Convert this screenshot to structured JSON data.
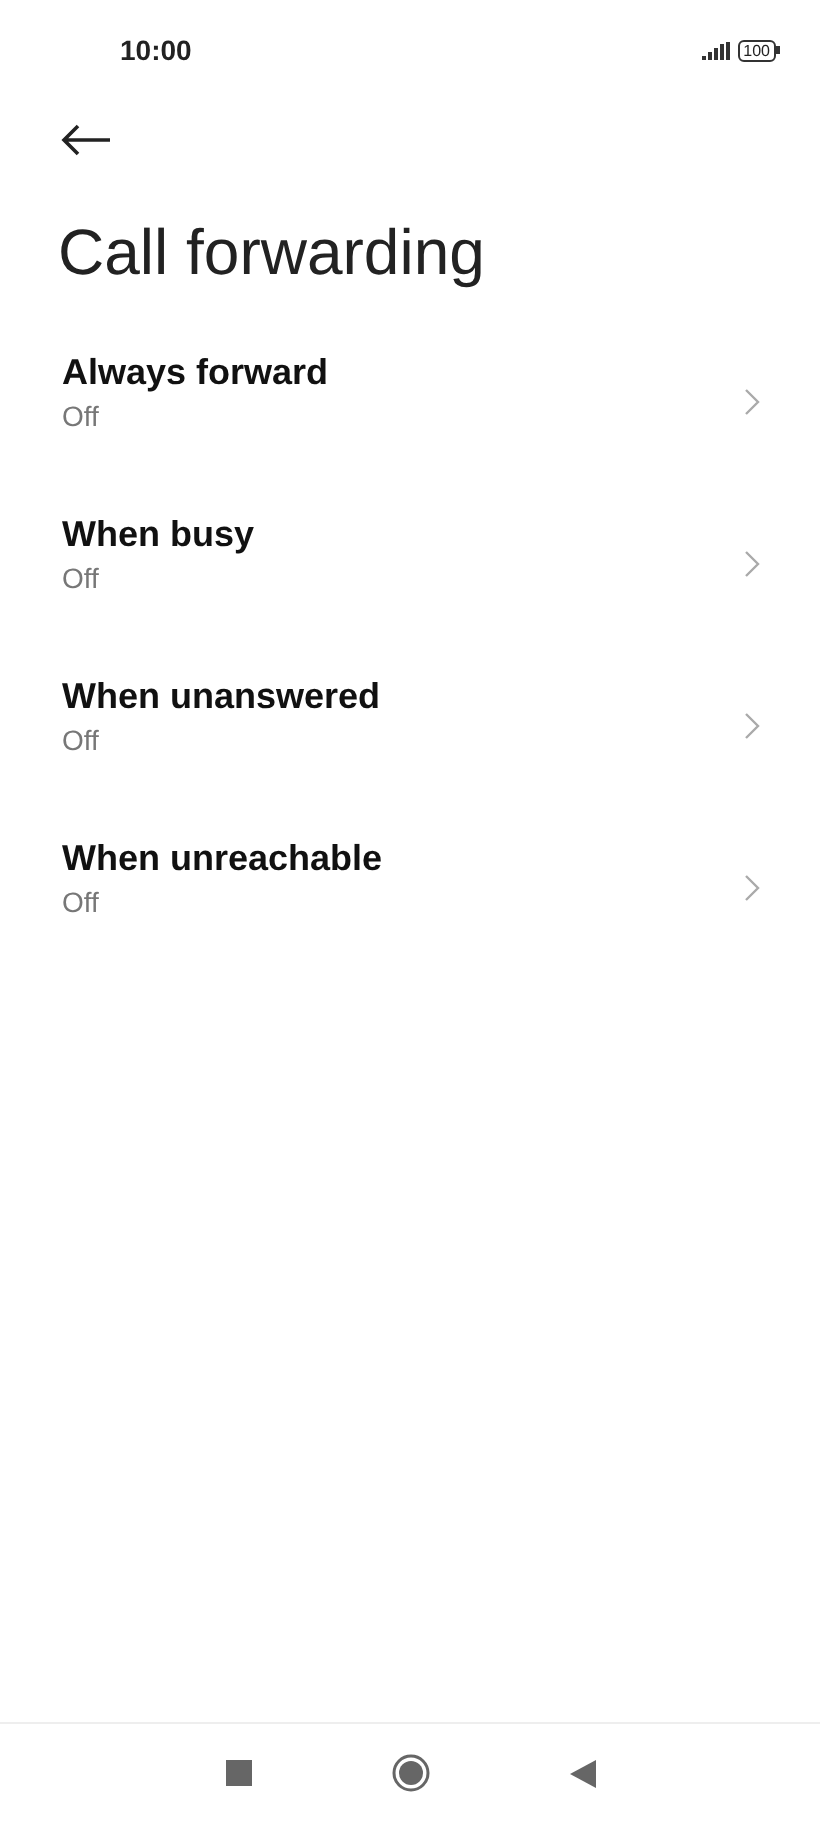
{
  "status_bar": {
    "time": "10:00",
    "battery": "100"
  },
  "title": "Call forwarding",
  "items": [
    {
      "label": "Always forward",
      "value": "Off"
    },
    {
      "label": "When busy",
      "value": "Off"
    },
    {
      "label": "When unanswered",
      "value": "Off"
    },
    {
      "label": "When unreachable",
      "value": "Off"
    }
  ]
}
